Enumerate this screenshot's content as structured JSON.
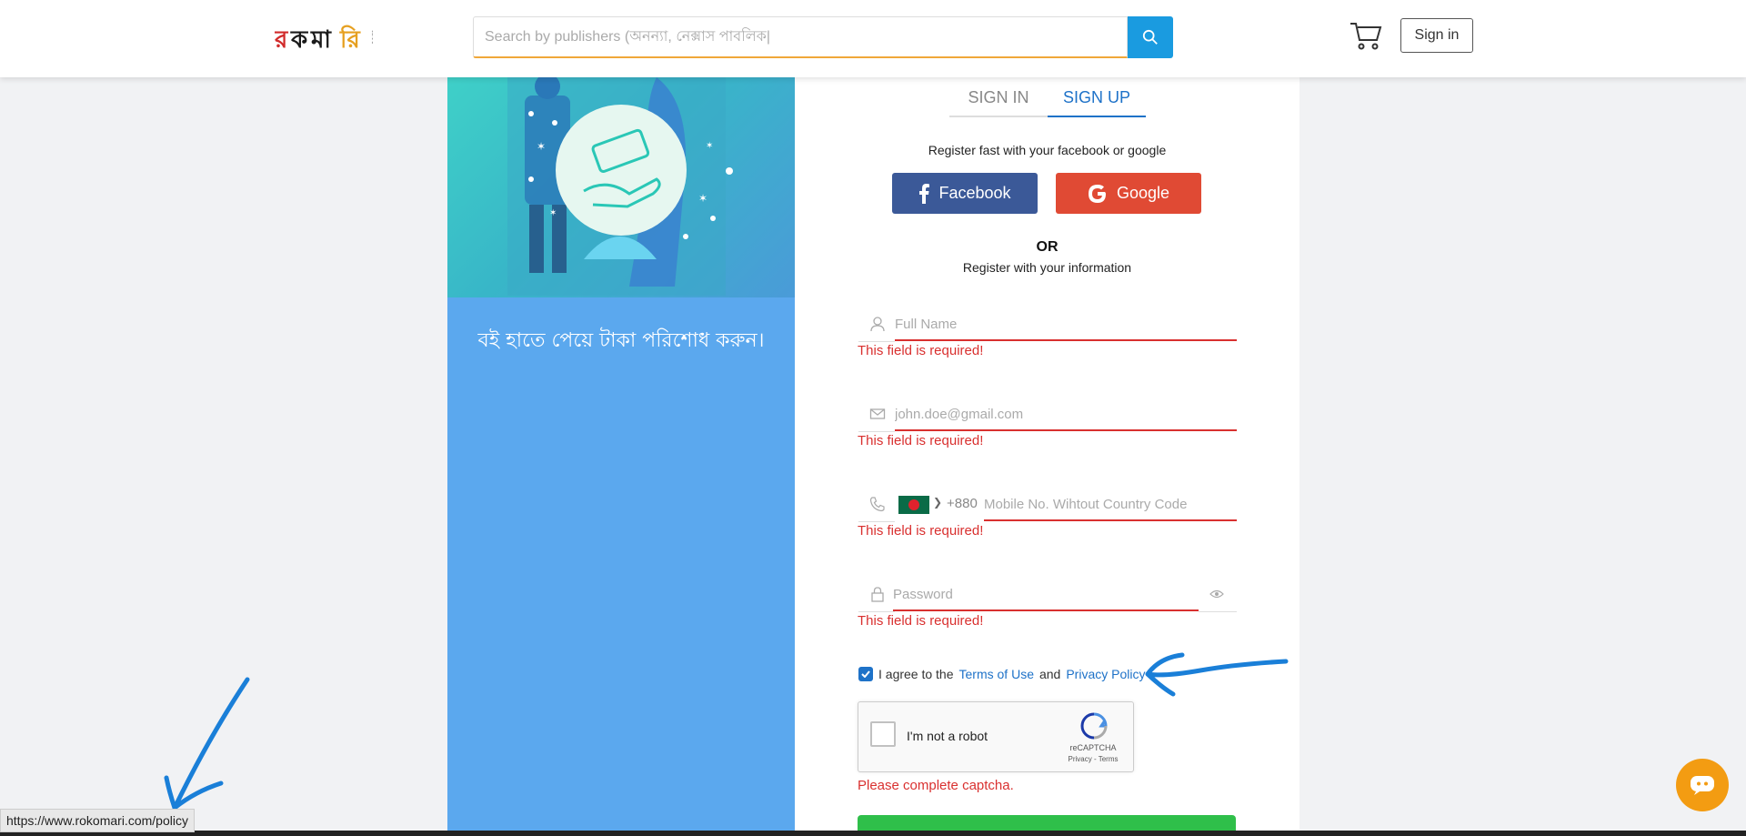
{
  "header": {
    "logo_text": "রকমারি.com",
    "search_placeholder": "Search by publishers (অনন্যা, নেক্সাস পাবলিক|",
    "signin_label": "Sign in"
  },
  "promo": {
    "caption": "বই হাতে পেয়ে টাকা পরিশোধ করুন।"
  },
  "auth": {
    "tabs": [
      "SIGN IN",
      "SIGN UP"
    ],
    "register_fast": "Register fast with your facebook or google",
    "facebook_label": "Facebook",
    "google_label": "Google",
    "or_label": "OR",
    "register_info": "Register with your information",
    "fields": {
      "full_name_placeholder": "Full Name",
      "email_placeholder": "john.doe@gmail.com",
      "country_code": "+880",
      "mobile_placeholder": "Mobile No. Wihtout Country Code",
      "password_placeholder": "Password"
    },
    "error_required": "This field is required!",
    "terms": {
      "prefix": "I agree to the",
      "terms_link": "Terms of Use",
      "and": "and",
      "privacy_link": "Privacy Policy",
      "checked": true
    },
    "captcha": {
      "label": "I'm not a robot",
      "brand": "reCAPTCHA",
      "sub": "Privacy - Terms"
    },
    "captcha_error": "Please complete captcha."
  },
  "status_bar": {
    "url": "https://www.rokomari.com/policy"
  },
  "colors": {
    "primary_blue": "#1e72c8",
    "error_red": "#d9302f",
    "facebook": "#3b5998",
    "google": "#e04a34",
    "annotation_blue": "#1a7fd8",
    "chat_orange": "#f39c12"
  }
}
